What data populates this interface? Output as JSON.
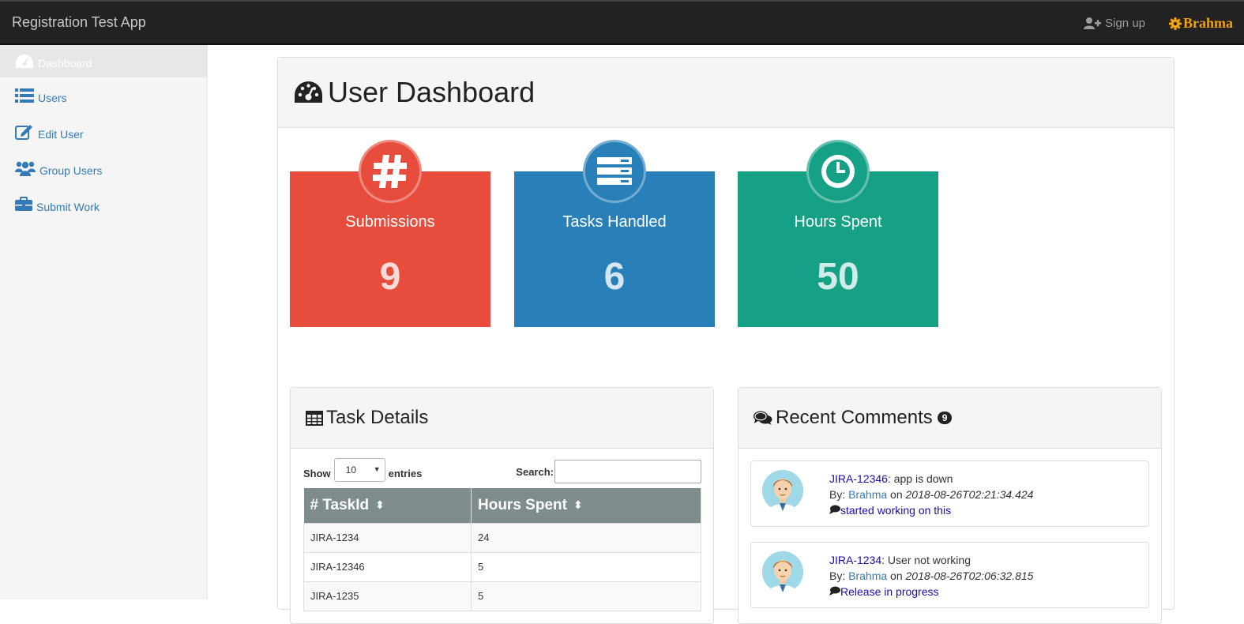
{
  "navbar": {
    "brand": "Registration Test App",
    "signup_label": "Sign up",
    "user_name": "Brahma"
  },
  "sidebar": {
    "items": [
      {
        "label": "Dashboard",
        "icon": "dashboard-icon",
        "active": true
      },
      {
        "label": "Users",
        "icon": "list-icon"
      },
      {
        "label": "Edit User",
        "icon": "edit-icon"
      },
      {
        "label": "Group Users",
        "icon": "group-icon"
      },
      {
        "label": "Submit Work",
        "icon": "briefcase-icon"
      }
    ]
  },
  "main": {
    "title": "User Dashboard",
    "tiles": [
      {
        "label": "Submissions",
        "value": "9",
        "icon": "hashtag-icon",
        "color": "#e74c3c"
      },
      {
        "label": "Tasks Handled",
        "value": "6",
        "icon": "server-icon",
        "color": "#2980b9"
      },
      {
        "label": "Hours Spent",
        "value": "50",
        "icon": "clock-icon",
        "color": "#16a085"
      }
    ]
  },
  "task_details": {
    "title": "Task Details",
    "show_label": "Show",
    "entries_value": "10",
    "entries_label": "entries",
    "search_label": "Search:",
    "columns": [
      "# TaskId",
      "Hours Spent"
    ],
    "rows": [
      [
        "JIRA-1234",
        "24"
      ],
      [
        "JIRA-12346",
        "5"
      ],
      [
        "JIRA-1235",
        "5"
      ]
    ]
  },
  "recent_comments": {
    "title": "Recent Comments",
    "count": "9",
    "items": [
      {
        "task": "JIRA-12346",
        "text": ": app is down",
        "by_label": "By:",
        "author": "Brahma",
        "on_label": "on",
        "timestamp": "2018-08-26T02:21:34.424",
        "status": "started working on this"
      },
      {
        "task": "JIRA-1234",
        "text": ": User not working",
        "by_label": "By:",
        "author": "Brahma",
        "on_label": "on",
        "timestamp": "2018-08-26T02:06:32.815",
        "status": "Release in progress"
      }
    ]
  }
}
